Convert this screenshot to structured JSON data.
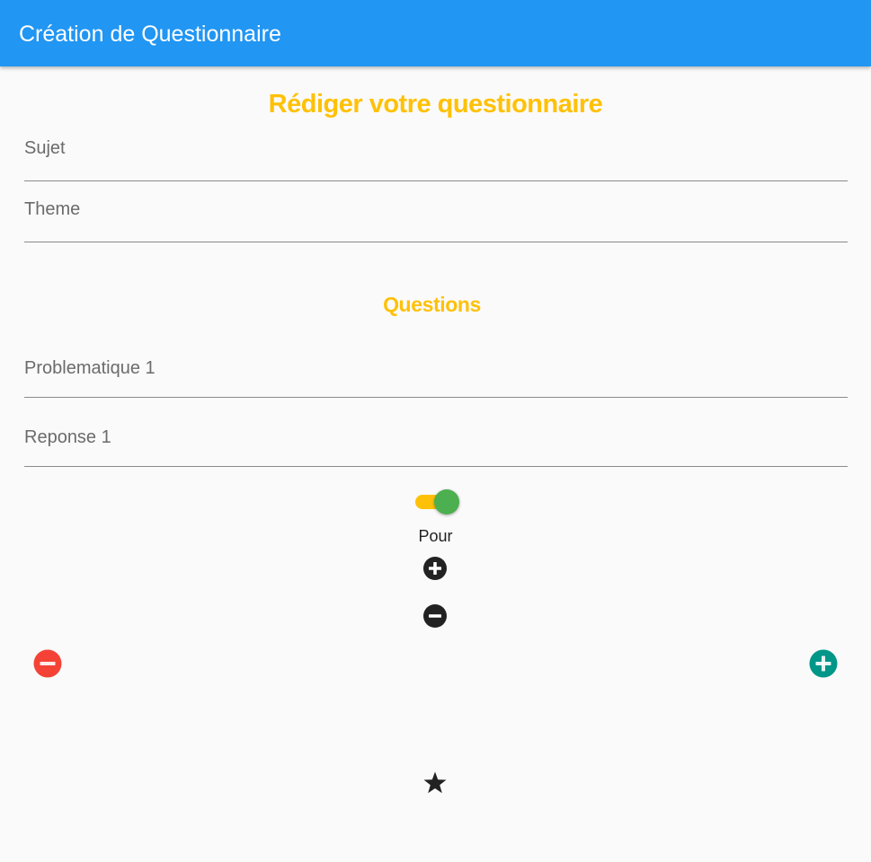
{
  "appbar": {
    "title": "Création de Questionnaire",
    "color": "#2196f3"
  },
  "form": {
    "heading": "Rédiger votre questionnaire",
    "sujet_placeholder": "Sujet",
    "theme_placeholder": "Theme"
  },
  "questions": {
    "heading": "Questions",
    "problem_placeholder": "Problematique 1",
    "answer_placeholder": "Reponse 1",
    "toggle_on": true,
    "toggle_label": "Pour"
  },
  "icons": {
    "add_answer": "add-circle-icon",
    "remove_answer": "remove-circle-icon",
    "remove_question": "remove-circle-icon",
    "add_question": "add-circle-icon",
    "submit": "star-icon"
  },
  "colors": {
    "heading": "#ffc107",
    "toggle_track": "#ffc107",
    "toggle_thumb": "#4caf50",
    "remove_question": "#f44336",
    "add_question": "#009688",
    "small_icons": "#222222"
  }
}
